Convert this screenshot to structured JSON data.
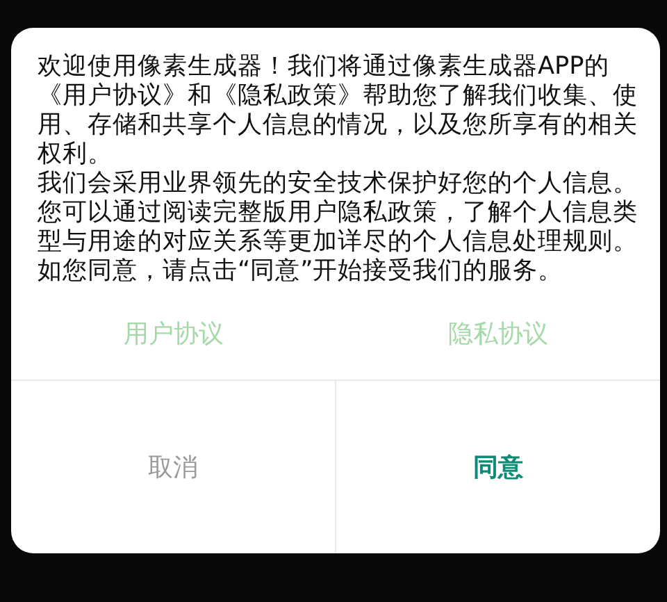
{
  "dialog": {
    "paragraphs": [
      "欢迎使用像素生成器！我们将通过像素生成器APP的《用户协议》和《隐私政策》帮助您了解我们收集、使用、存储和共享个人信息的情况，以及您所享有的相关权利。",
      "我们会采用业界领先的安全技术保护好您的个人信息。",
      "您可以通过阅读完整版用户隐私政策，了解个人信息类型与用途的对应关系等更加详尽的个人信息处理规则。",
      "如您同意，请点击“同意”开始接受我们的服务。"
    ],
    "links": [
      "用户协议",
      "隐私协议"
    ],
    "buttons": [
      {
        "label": "取消",
        "kind": "secondary"
      },
      {
        "label": "同意",
        "kind": "primary"
      }
    ]
  }
}
